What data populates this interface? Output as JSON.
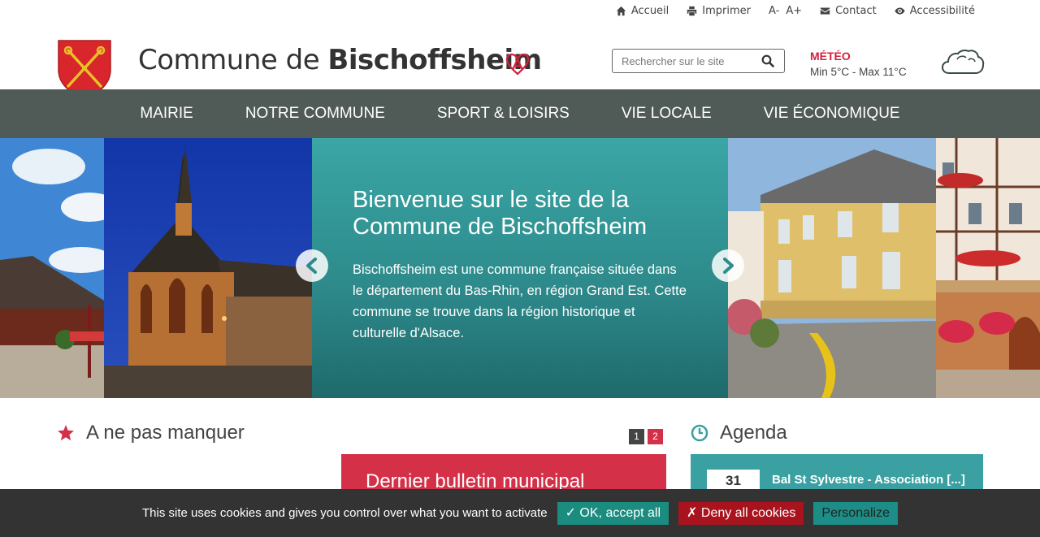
{
  "topbar": {
    "home": "Accueil",
    "print": "Imprimer",
    "font_smaller": "A-",
    "font_larger": "A+",
    "contact": "Contact",
    "accessibility": "Accessibilité"
  },
  "header": {
    "title_prefix": "Commune de ",
    "title_name": "Bischoffsheim",
    "search_placeholder": "Rechercher sur le site",
    "meteo_label": "MÉTÉO",
    "meteo_temps": "Min 5°C - Max 11°C"
  },
  "nav": {
    "items": [
      "MAIRIE",
      "NOTRE COMMUNE",
      "SPORT & LOISIRS",
      "VIE LOCALE",
      "VIE ÉCONOMIQUE"
    ]
  },
  "slider": {
    "title": "Bienvenue sur le site de la Commune de Bischoffsheim",
    "text": "Bischoffsheim est une commune française située dans le département du Bas-Rhin, en région Grand Est. Cette commune se trouve dans la région historique et culturelle d'Alsace."
  },
  "news": {
    "heading": "A ne pas manquer",
    "pages": [
      "1",
      "2"
    ],
    "card_title": "Dernier bulletin municipal"
  },
  "agenda": {
    "heading": "Agenda",
    "event_day": "31",
    "event_title": "Bal St Sylvestre - Association [...]"
  },
  "cookie": {
    "text": "This site uses cookies and gives you control over what you want to activate",
    "accept": "✓ OK, accept all",
    "deny": "✗ Deny all cookies",
    "personalize": "Personalize"
  },
  "colors": {
    "nav_bg": "#505a57",
    "accent_red": "#d43149",
    "accent_teal": "#3aa0a1",
    "cookie_bg": "#333333"
  }
}
